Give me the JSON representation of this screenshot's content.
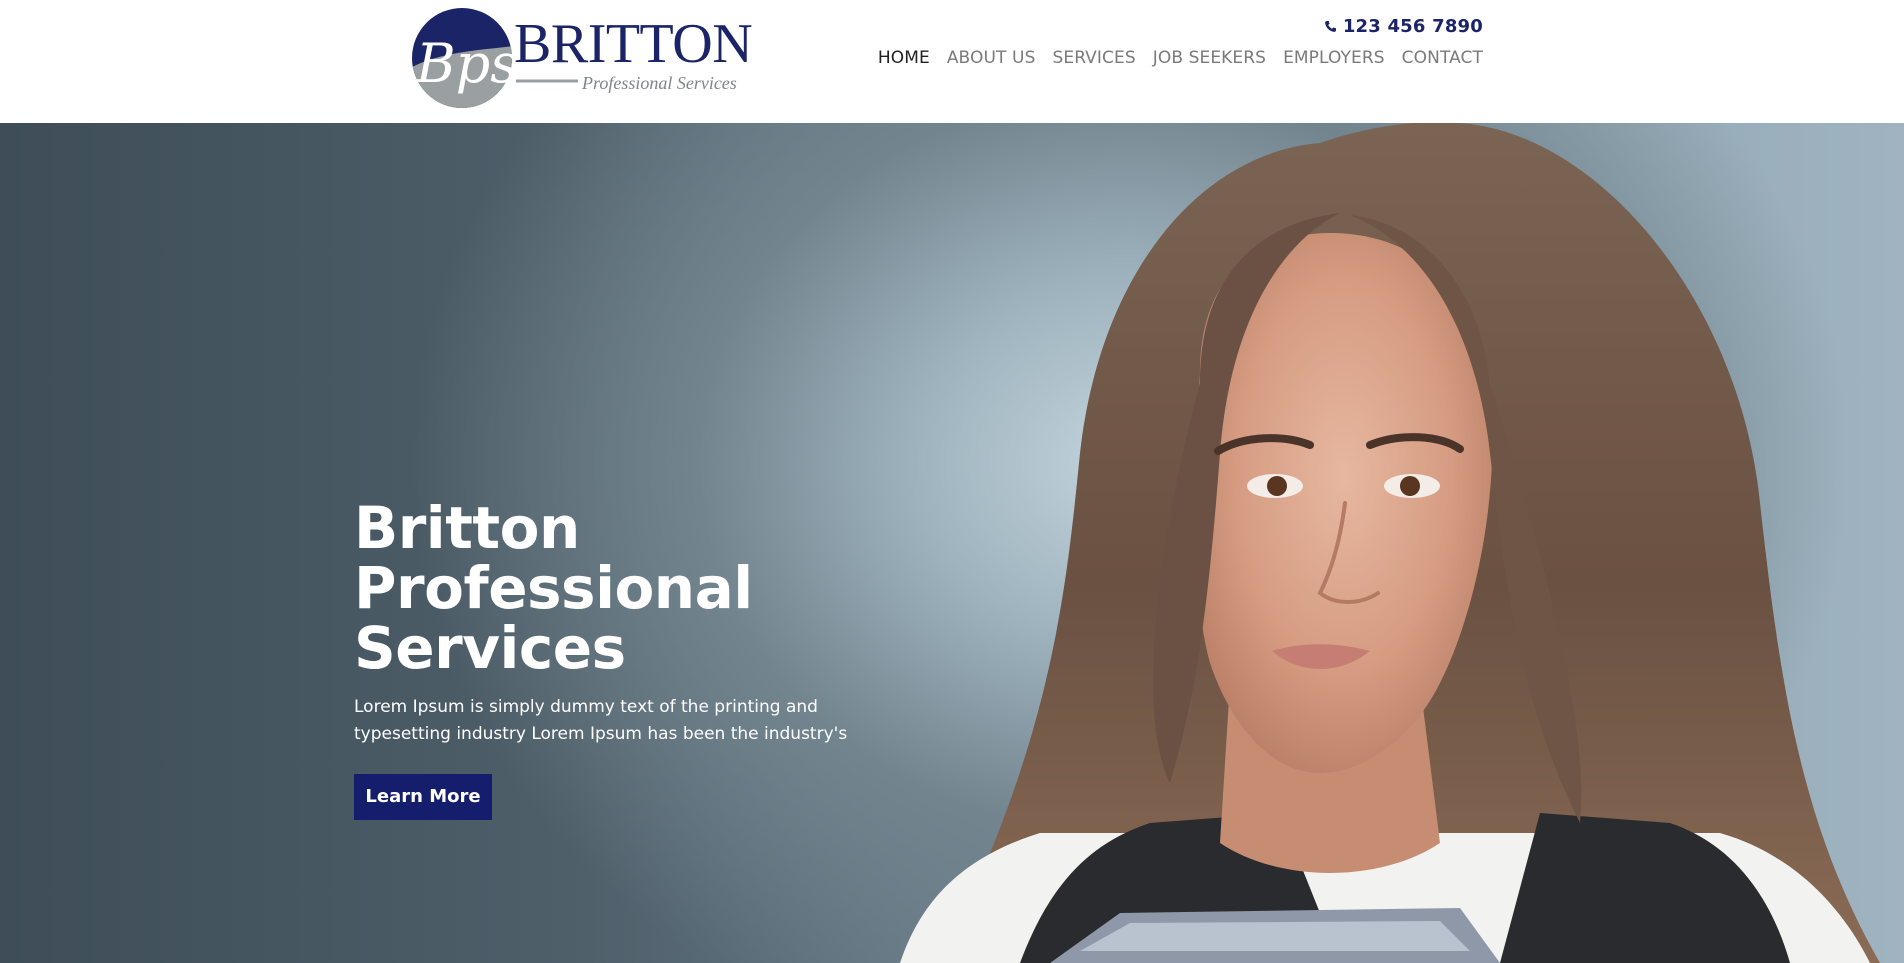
{
  "brand": {
    "logo_monogram": "Bps",
    "logo_name": "BRITTON",
    "logo_tagline": "Professional Services",
    "colors": {
      "navy": "#1a2466",
      "logo_gray": "#9a9fa2",
      "button": "#141e6c"
    }
  },
  "header": {
    "phone_icon": "phone-icon",
    "phone": "123 456 7890"
  },
  "nav": {
    "items": [
      {
        "label": "HOME",
        "active": true
      },
      {
        "label": "ABOUT US",
        "active": false
      },
      {
        "label": "SERVICES",
        "active": false
      },
      {
        "label": "JOB SEEKERS",
        "active": false
      },
      {
        "label": "EMPLOYERS",
        "active": false
      },
      {
        "label": "CONTACT",
        "active": false
      }
    ]
  },
  "hero": {
    "title_line1": "Britton",
    "title_line2": "Professional Services",
    "text": "Lorem Ipsum is simply dummy text of the printing and typesetting industry Lorem Ipsum has been the industry's",
    "button_label": "Learn More"
  }
}
